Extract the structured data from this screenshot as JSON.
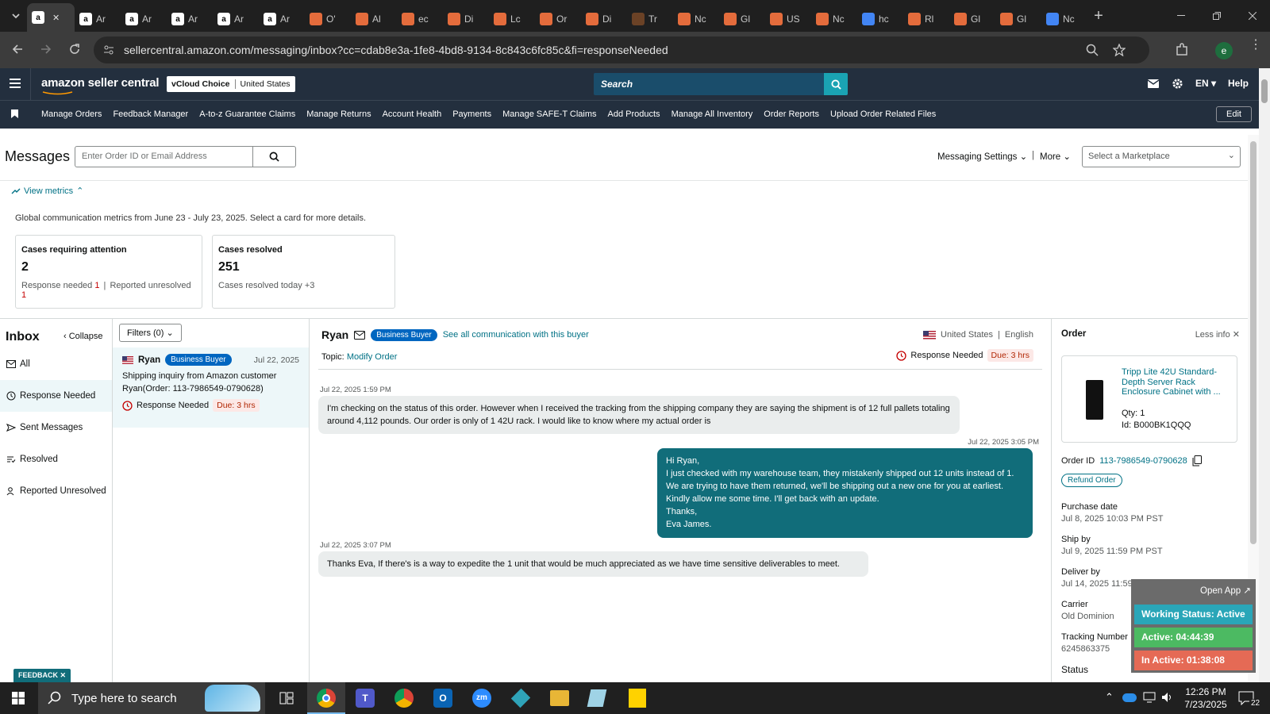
{
  "browser": {
    "tabs": [
      {
        "label": "",
        "icon": "amazon-icon",
        "active": true
      },
      {
        "label": "Ar",
        "icon": "amazon-icon"
      },
      {
        "label": "Ar",
        "icon": "amazon-icon"
      },
      {
        "label": "Ar",
        "icon": "amazon-icon"
      },
      {
        "label": "Ar",
        "icon": "amazon-icon"
      },
      {
        "label": "Ar",
        "icon": "amazon-icon"
      },
      {
        "label": "O'",
        "icon": "site-icon"
      },
      {
        "label": "Al",
        "icon": "site-icon"
      },
      {
        "label": "ec",
        "icon": "site-icon"
      },
      {
        "label": "Di",
        "icon": "site-icon"
      },
      {
        "label": "Lc",
        "icon": "site-icon"
      },
      {
        "label": "Or",
        "icon": "site-icon"
      },
      {
        "label": "Di",
        "icon": "site-icon"
      },
      {
        "label": "Tr",
        "icon": "ups-icon"
      },
      {
        "label": "Nc",
        "icon": "site-icon"
      },
      {
        "label": "Gl",
        "icon": "site-icon"
      },
      {
        "label": "US",
        "icon": "site-icon"
      },
      {
        "label": "Nc",
        "icon": "site-icon"
      },
      {
        "label": "hc",
        "icon": "google-icon"
      },
      {
        "label": "Rl",
        "icon": "site-icon"
      },
      {
        "label": "Gl",
        "icon": "site-icon"
      },
      {
        "label": "Gl",
        "icon": "site-icon"
      },
      {
        "label": "Nc",
        "icon": "google-icon"
      }
    ],
    "url": "sellercentral.amazon.com/messaging/inbox?cc=cdab8e3a-1fe8-4bd8-9134-8c843c6fc85c&fi=responseNeeded",
    "profile_initial": "e"
  },
  "header": {
    "logo": "amazon seller central",
    "store": "vCloud Choice",
    "country": "United States",
    "search_placeholder": "Search",
    "lang": "EN",
    "help": "Help"
  },
  "nav": {
    "items": [
      "Manage Orders",
      "Feedback Manager",
      "A-to-z Guarantee Claims",
      "Manage Returns",
      "Account Health",
      "Payments",
      "Manage SAFE-T Claims",
      "Add Products",
      "Manage All Inventory",
      "Order Reports",
      "Upload Order Related Files"
    ],
    "edit": "Edit"
  },
  "page": {
    "title": "Messages",
    "search_placeholder": "Enter Order ID or Email Address",
    "settings": "Messaging Settings",
    "more": "More",
    "marketplace_placeholder": "Select a Marketplace",
    "view_metrics": "View metrics",
    "metrics_caption": "Global communication metrics from June 23 - July 23, 2025. Select a card for more details."
  },
  "metrics": {
    "attention": {
      "title": "Cases requiring attention",
      "value": "2",
      "response_label": "Response needed",
      "response_count": "1",
      "reported_label": "Reported unresolved",
      "reported_count": "1"
    },
    "resolved": {
      "title": "Cases resolved",
      "value": "251",
      "today_label": "Cases resolved today",
      "today_count": "+3"
    }
  },
  "inbox": {
    "title": "Inbox",
    "collapse": "Collapse",
    "filters": "Filters (0)",
    "folders": [
      "All",
      "Response Needed",
      "Sent Messages",
      "Resolved",
      "Reported Unresolved"
    ],
    "item": {
      "name": "Ryan",
      "badge": "Business Buyer",
      "date": "Jul 22, 2025",
      "subject": "Shipping inquiry from Amazon customer Ryan(Order: 113-7986549-0790628)",
      "status": "Response Needed",
      "due": "Due: 3 hrs"
    }
  },
  "conversation": {
    "buyer": "Ryan",
    "badge": "Business Buyer",
    "see_all": "See all communication with this buyer",
    "country": "United States",
    "language": "English",
    "topic_label": "Topic:",
    "topic": "Modify Order",
    "status": "Response Needed",
    "due": "Due: 3 hrs",
    "messages": [
      {
        "time": "Jul 22, 2025 1:59 PM",
        "text": "I'm checking on the status of this order. However when I received the tracking from the shipping company they are saying the shipment is of 12 full pallets totaling around 4,112 pounds. Our order is only of 1 42U rack. I would like to know where my actual order is"
      },
      {
        "time": "Jul 22, 2025 3:05 PM",
        "lines": [
          "Hi Ryan,",
          "I just checked with my warehouse team, they mistakenly shipped out 12 units instead of 1.",
          "We are trying to have them returned, we'll be shipping out a new one for you at earliest.",
          "Kindly allow me some time. I'll get back with an update.",
          "Thanks,",
          "Eva James."
        ]
      },
      {
        "time": "Jul 22, 2025 3:07 PM",
        "text": "Thanks Eva, If there's is a way to expedite the 1 unit that would be much appreciated as we have time sensitive deliverables to meet."
      }
    ]
  },
  "order": {
    "title": "Order",
    "less_info": "Less info",
    "product": "Tripp Lite 42U Standard-Depth Server Rack Enclosure Cabinet with ...",
    "qty": "Qty: 1",
    "id": "Id: B000BK1QQQ",
    "order_id_label": "Order ID",
    "order_id": "113-7986549-0790628",
    "refund": "Refund Order",
    "purchase_label": "Purchase date",
    "purchase": "Jul 8, 2025 10:03 PM PST",
    "ship_label": "Ship by",
    "ship": "Jul 9, 2025 11:59 PM PST",
    "deliver_label": "Deliver by",
    "deliver": "Jul 14, 2025 11:59 PM PST",
    "carrier_label": "Carrier",
    "carrier": "Old Dominion",
    "tracking_label": "Tracking Number",
    "tracking": "6245863375",
    "status_label": "Status"
  },
  "widget": {
    "open_app": "Open App",
    "working": "Working Status: Active",
    "active": "Active: 04:44:39",
    "inactive": "In Active: 01:38:08"
  },
  "feedback": "FEEDBACK",
  "taskbar": {
    "search": "Type here to search",
    "time": "12:26 PM",
    "date": "7/23/2025",
    "notifications": "22"
  },
  "colors": {
    "amazon_dark": "#232f3e",
    "teal": "#116d7a",
    "accent_link": "#007185",
    "search_teal": "#1aa3b3"
  }
}
